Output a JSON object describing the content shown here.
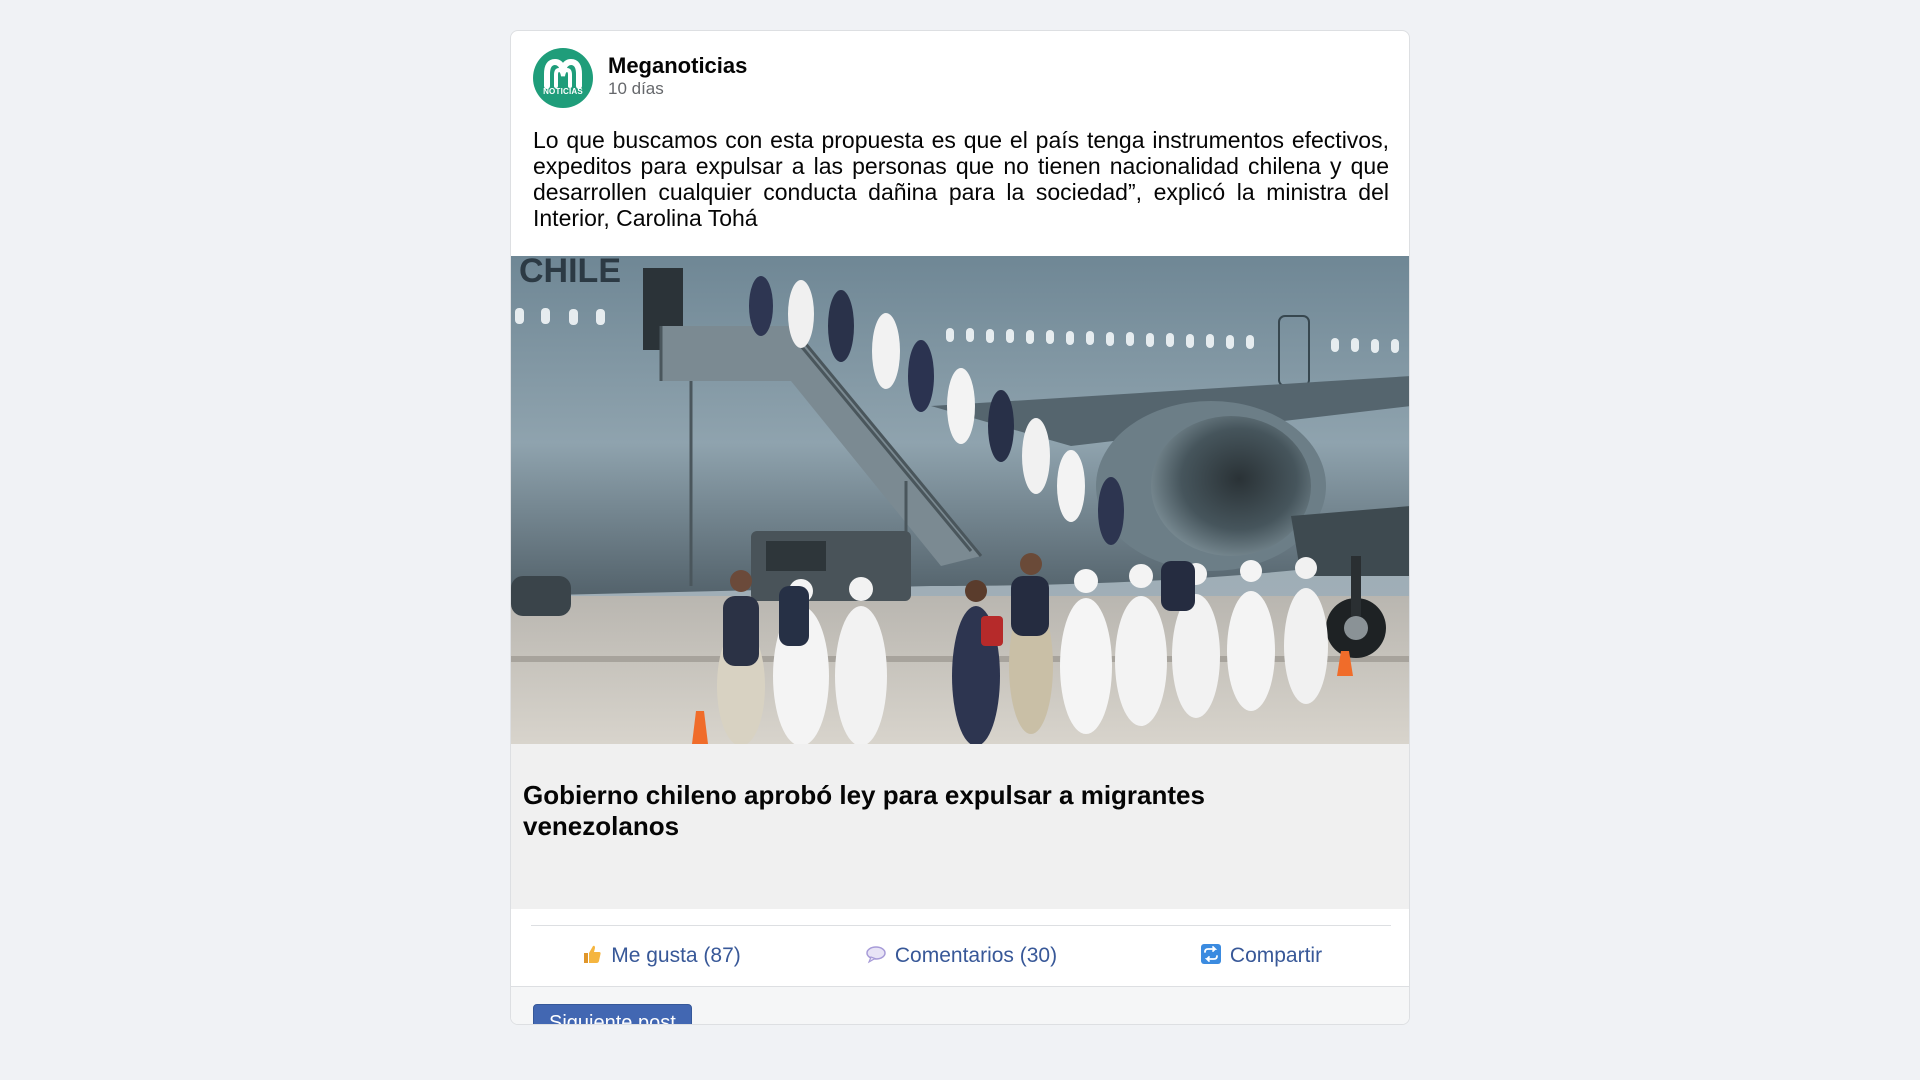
{
  "post": {
    "page_name": "Meganoticias",
    "avatar_label": "NOTICIAS",
    "timestamp": "10 días",
    "caption": "Lo que buscamos con esta propuesta es que el país tenga instrumentos efectivos, expeditos para expulsar a las personas que no tienen nacionalidad chilena y que desarrollen cualquier conducta dañina para la sociedad”, explicó la ministra del Interior, Carolina Tohá",
    "photo": {
      "fuselage_text": "CHILE"
    },
    "link_title": "Gobierno chileno aprobó ley para expulsar a migrantes venezolanos"
  },
  "actions": {
    "like_icon": "thumbs-up-icon",
    "like_label": "Me gusta (87)",
    "comment_icon": "speech-bubble-icon",
    "comment_label": "Comentarios (30)",
    "share_icon": "share-icon",
    "share_label": "Compartir"
  },
  "footer": {
    "next_label": "Siguiente post"
  },
  "colors": {
    "brand_green": "#1f9d7a",
    "link_blue": "#385898",
    "button_blue": "#4267b2",
    "page_background": "#f0f2f5"
  }
}
